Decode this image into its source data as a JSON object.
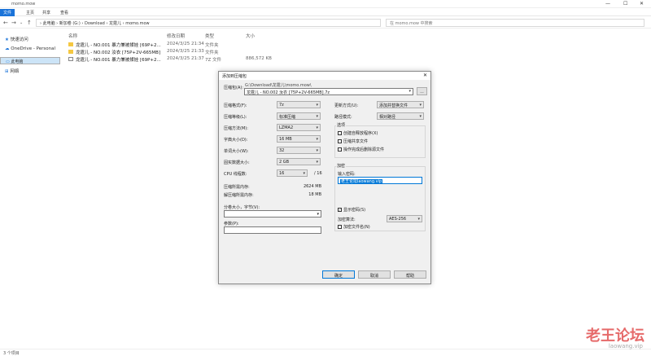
{
  "window": {
    "title": "momo.mow"
  },
  "ribbon": {
    "tabs": [
      "文件",
      "主页",
      "共享",
      "查看"
    ]
  },
  "address": {
    "path": "› 此电脑 › 新加卷 (G:) › Download › 龙霆儿 › momo.mow",
    "search": "在 momo.mow 中搜索"
  },
  "sidebar": {
    "items": [
      "快速访问",
      "OneDrive - Personal",
      "此电脑",
      "网络"
    ]
  },
  "columns": {
    "name": "名称",
    "date": "修改日期",
    "type": "类型",
    "size": "大小"
  },
  "files": [
    {
      "name": "龙霆儿 - NO.001 暴力兼被揉娃 [69P+2...",
      "date": "2024/3/25 21:34",
      "type": "文件夹",
      "size": ""
    },
    {
      "name": "龙霆儿 - NO.002 汝衣 [75P+2V-665MB]",
      "date": "2024/3/25 21:33",
      "type": "文件夹",
      "size": ""
    },
    {
      "name": "龙霆儿 - NO.001 暴力兼被揉娃 [69P+2...",
      "date": "2024/3/25 21:37",
      "type": "7Z 文件",
      "size": "886,572 KB"
    }
  ],
  "status": {
    "count": "3 个项目"
  },
  "watermark": {
    "text": "老王论坛",
    "url": "laowang.vip"
  },
  "dialog": {
    "title": "添加到压缩包",
    "archive_label": "压缩包(A):",
    "archive_dir": "G:\\Download\\龙霆儿\\momo.mow\\",
    "archive_name": "龙霆儿 - NO.002 汝衣 [75P+2V-665MB].7z",
    "browse": "...",
    "format_label": "压缩格式(F):",
    "format": "7z",
    "level_label": "压缩等级(L):",
    "level": "标准压缩",
    "method_label": "压缩方法(M):",
    "method": "LZMA2",
    "dict_label": "字典大小(D):",
    "dict": "16 MB",
    "word_label": "单词大小(W):",
    "word": "32",
    "solid_label": "固实数据大小:",
    "solid": "2 GB",
    "cpu_label": "CPU 线程数:",
    "cpu": "16",
    "cpu_total": "/ 16",
    "mem_comp_label": "压缩所需内存:",
    "mem_comp": "2624 MB",
    "mem_decomp_label": "解压缩所需内存:",
    "mem_decomp": "18 MB",
    "split_label": "分卷大小，字节(V):",
    "params_label": "参数(P):",
    "update_label": "更新方式(U):",
    "update": "添加并替换文件",
    "path_label": "路径模式:",
    "path": "相对路径",
    "options_title": "选项",
    "options": [
      "创建自释放程序(X)",
      "压缩共享文件",
      "操作完成后删除源文件"
    ],
    "enc_title": "加密",
    "pwd_label": "输入密码:",
    "pwd": "老王论坛laowang.vip",
    "show_pwd": "显示密码(S)",
    "enc_method_label": "加密算法:",
    "enc_method": "AES-256",
    "enc_names": "加密文件名(N)",
    "ok": "确定",
    "cancel": "取消",
    "help": "帮助"
  }
}
